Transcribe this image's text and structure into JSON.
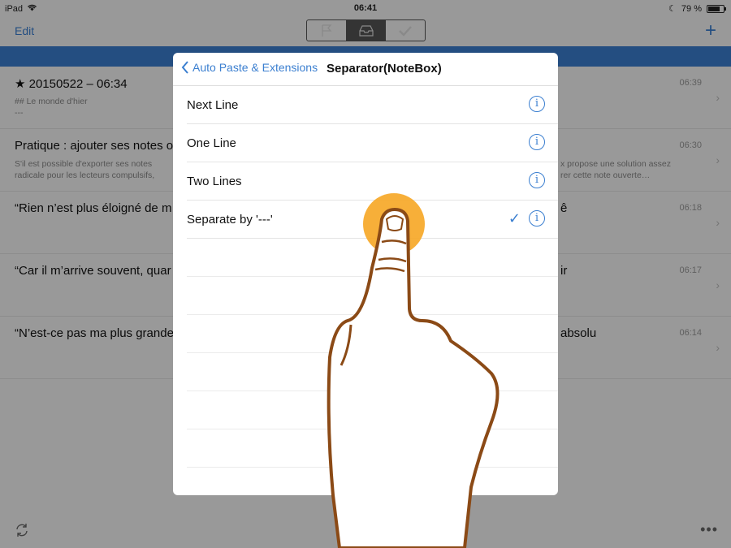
{
  "status_bar": {
    "device": "iPad",
    "time": "06:41",
    "battery_text": "79 %",
    "battery_level": 0.79
  },
  "nav": {
    "edit_label": "Edit",
    "segments": [
      "flag-icon",
      "inbox-icon",
      "checkmark-icon"
    ],
    "active_segment": 1
  },
  "notes": [
    {
      "title": "★ 20150522 – 06:34",
      "title_right": "",
      "preview_lines": [
        "## Le monde d'hier",
        "---"
      ],
      "preview_right_lines": [],
      "time": "06:39"
    },
    {
      "title": "Pratique : ajouter ses notes o",
      "title_right": "",
      "preview_lines": [
        "S'il est possible d'exporter ses notes",
        "radicale pour les lecteurs compulsifs,"
      ],
      "preview_right_lines": [
        "x propose une solution assez",
        "rer cette note ouverte…"
      ],
      "time": "06:30"
    },
    {
      "title": "“Rien n’est plus éloigné de m",
      "title_right": "ê",
      "preview_lines": [],
      "preview_right_lines": [],
      "time": "06:18"
    },
    {
      "title": "“Car il m’arrive souvent, quar",
      "title_right": "ir",
      "preview_lines": [],
      "preview_right_lines": [],
      "time": "06:17"
    },
    {
      "title": "“N’est-ce pas ma plus grande",
      "title_right": "absolu",
      "preview_lines": [],
      "preview_right_lines": [],
      "time": "06:14"
    }
  ],
  "popover": {
    "back_label": "Auto Paste & Extensions",
    "title": "Separator(NoteBox)",
    "options": [
      {
        "label": "Next Line",
        "selected": false
      },
      {
        "label": "One Line",
        "selected": false
      },
      {
        "label": "Two Lines",
        "selected": false
      },
      {
        "label": "Separate by '---'",
        "selected": true
      }
    ],
    "check_glyph": "✓",
    "info_glyph": "i"
  },
  "colors": {
    "accent": "#3b7fd0",
    "band": "#3b7fd0",
    "touch": "#f6a623",
    "hand_outline": "#8b4a16"
  }
}
